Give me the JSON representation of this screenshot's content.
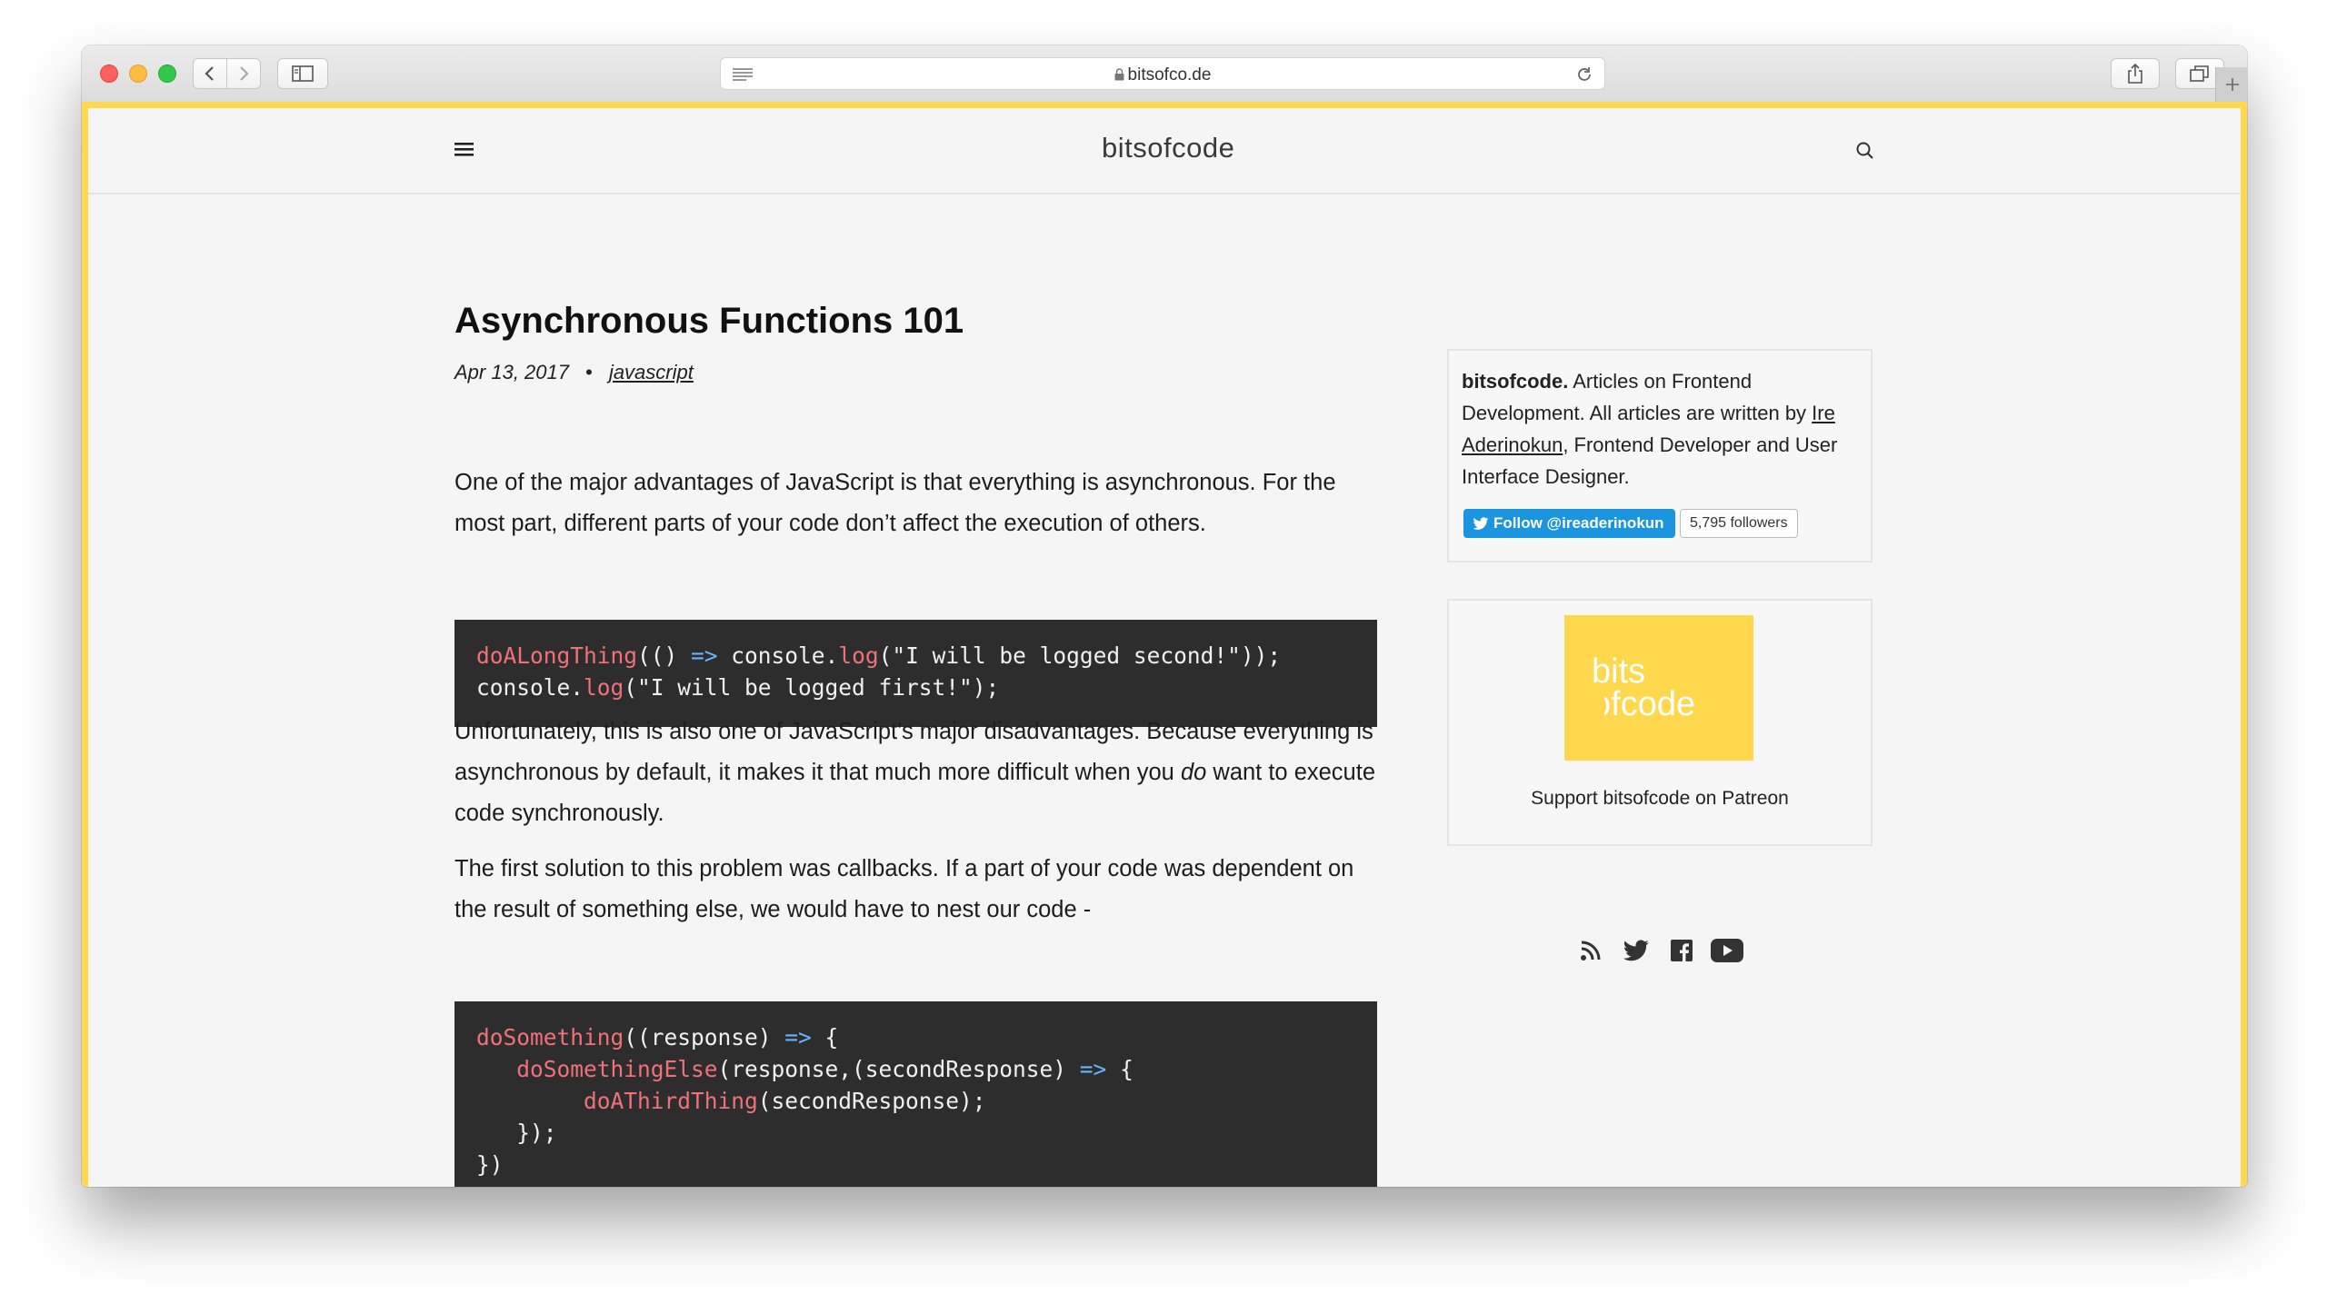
{
  "browser": {
    "url": "bitsofco.de",
    "icons": [
      "back-icon",
      "forward-icon",
      "sidebar-icon",
      "reader-icon",
      "lock-icon",
      "reload-icon",
      "share-icon",
      "tabs-icon",
      "new-tab-icon"
    ]
  },
  "site": {
    "logo": "bitsofcode",
    "menu_icon": "hamburger-menu-icon",
    "search_icon": "search-icon"
  },
  "article": {
    "title": "Asynchronous Functions 101",
    "date": "Apr 13, 2017",
    "bullet": "•",
    "tag": "javascript",
    "p1": "One of the major advantages of JavaScript is that everything is asynchronous. For the most part, different parts of your code don’t affect the execution of others.",
    "p2_before": "Unfortunately, this is also one of JavaScript's major disadvantages. Because everything is asynchronous by default, it makes it that much more difficult when you ",
    "p2_em": "do",
    "p2_after": " want to execute code synchronously.",
    "p3": "The first solution to this problem was callbacks. If a part of your code was dependent on the result of something else, we would have to nest our code -"
  },
  "code1": {
    "l1_fn": "doALongThing",
    "l1_a": "(() ",
    "l1_arrow": "=>",
    "l1_b": " console.",
    "l1_log": "log",
    "l1_c": "(\"I will be logged second!\"));",
    "l2_a": "console.",
    "l2_log": "log",
    "l2_b": "(\"I will be logged first!\");"
  },
  "code2": {
    "l1_fn": "doSomething",
    "l1_a": "((response) ",
    "l1_arrow": "=>",
    "l1_b": " {",
    "l2_indent": "   ",
    "l2_fn": "doSomethingElse",
    "l2_a": "(response,(secondResponse) ",
    "l2_arrow": "=>",
    "l2_b": " {",
    "l3_indent": "        ",
    "l3_fn": "doAThirdThing",
    "l3_a": "(secondResponse);",
    "l4": "   });",
    "l5": "})"
  },
  "sidebar": {
    "about_name": "bitsofcode.",
    "about_text": " Articles on Frontend Development. All articles are written by ",
    "author_link": "Ire Aderinokun",
    "about_tail": ", Frontend Developer and User Interface Designer.",
    "follow_label": "Follow @ireaderinokun",
    "followers": "5,795 followers",
    "patreon_logo": "bitsofcode",
    "patreon_label": "Support bitsofcode on Patreon",
    "social_icons": [
      "rss-icon",
      "twitter-icon",
      "facebook-icon",
      "youtube-icon"
    ]
  },
  "colors": {
    "accent_border": "#ffd84d",
    "code_bg": "#2d2d2d",
    "code_function": "#f07178",
    "code_arrow": "#69b4ff",
    "twitter_blue": "#1b95e0"
  }
}
